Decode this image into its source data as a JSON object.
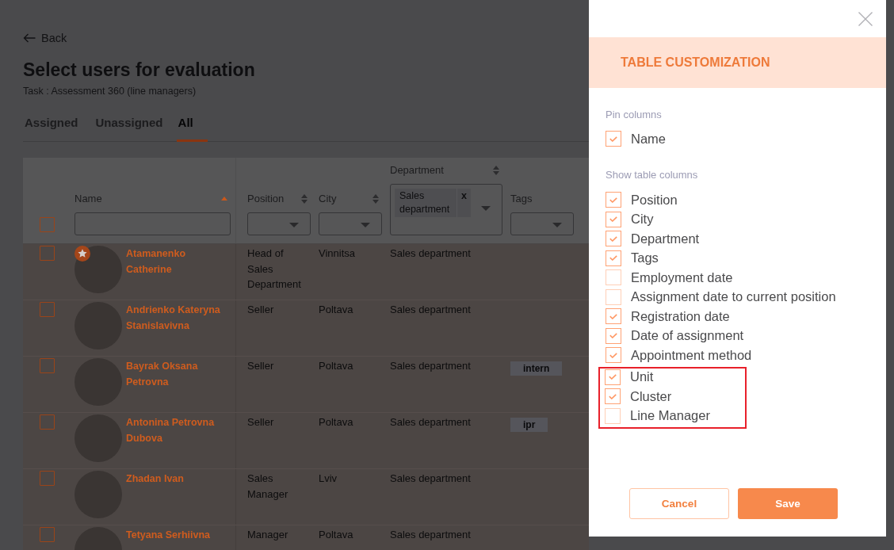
{
  "page": {
    "back": "Back",
    "title": "Select users for evaluation",
    "subtitle": "Task : Assessment 360 (line managers)"
  },
  "tabs": [
    {
      "label": "Assigned",
      "selected": false
    },
    {
      "label": "Unassigned",
      "selected": false
    },
    {
      "label": "All",
      "selected": true
    }
  ],
  "table": {
    "select_all_checked": false,
    "columns": [
      {
        "label": "Name",
        "sortable": true,
        "sorted": true,
        "kind": "text"
      },
      {
        "label": "Position",
        "sortable": true,
        "sorted": false,
        "kind": "select"
      },
      {
        "label": "City",
        "sortable": true,
        "sorted": false,
        "kind": "select"
      },
      {
        "label": "Department",
        "sortable": true,
        "sorted": false,
        "kind": "multiselect",
        "chips": [
          {
            "label": "Sales department",
            "remove": "x"
          }
        ]
      },
      {
        "label": "Tags",
        "sortable": false,
        "kind": "select"
      }
    ],
    "rows": [
      {
        "checked": false,
        "starred": true,
        "name": "Atamanenko Catherine",
        "position": "Head of Sales Department",
        "city": "Vinnitsa",
        "department": "Sales department"
      },
      {
        "checked": false,
        "starred": false,
        "name": "Andrienko Kateryna Stanislavivna",
        "position": "Seller",
        "city": "Poltava",
        "department": "Sales department"
      },
      {
        "checked": false,
        "starred": false,
        "name": "Bayrak Oksana Petrovna",
        "position": "Seller",
        "city": "Poltava",
        "department": "Sales department",
        "tags": [
          "intern"
        ]
      },
      {
        "checked": false,
        "starred": false,
        "name": "Antonina Petrovna Dubova",
        "position": "Seller",
        "city": "Poltava",
        "department": "Sales department",
        "tags": [
          "ipr"
        ]
      },
      {
        "checked": false,
        "starred": false,
        "name": "Zhadan Ivan",
        "position": "Sales Manager",
        "city": "Lviv",
        "department": "Sales department"
      },
      {
        "checked": false,
        "starred": false,
        "name": "Tetyana Serhiivna",
        "position": "Manager",
        "city": "Poltava",
        "department": "Sales department"
      }
    ]
  },
  "drawer": {
    "title": "TABLE CUSTOMIZATION",
    "pin_label": "Pin columns",
    "pinned": [
      {
        "label": "Name",
        "checked": true
      }
    ],
    "show_label": "Show table columns",
    "columns": [
      {
        "label": "Position",
        "checked": true,
        "highlighted": false
      },
      {
        "label": "City",
        "checked": true,
        "highlighted": false
      },
      {
        "label": "Department",
        "checked": true,
        "highlighted": false
      },
      {
        "label": "Tags",
        "checked": true,
        "highlighted": false
      },
      {
        "label": "Employment date",
        "checked": false,
        "highlighted": false
      },
      {
        "label": "Assignment date to current position",
        "checked": false,
        "highlighted": false
      },
      {
        "label": "Registration date",
        "checked": true,
        "highlighted": false
      },
      {
        "label": "Date of assignment",
        "checked": true,
        "highlighted": false
      },
      {
        "label": "Appointment method",
        "checked": true,
        "highlighted": false
      },
      {
        "label": "Unit",
        "checked": true,
        "highlighted": true
      },
      {
        "label": "Cluster",
        "checked": true,
        "highlighted": true
      },
      {
        "label": "Line Manager",
        "checked": false,
        "highlighted": true
      }
    ],
    "buttons": [
      {
        "label": "Cancel",
        "kind": "secondary"
      },
      {
        "label": "Save",
        "kind": "primary"
      }
    ]
  }
}
